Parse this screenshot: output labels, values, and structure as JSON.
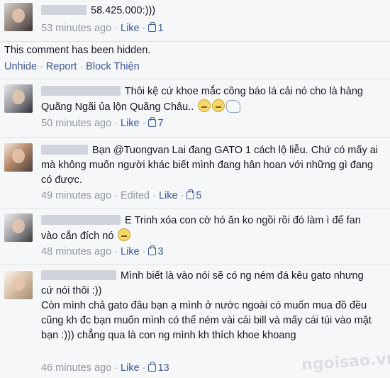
{
  "comments": [
    {
      "text": "58.425.000:)))",
      "time": "53 minutes ago",
      "edited": "",
      "like_label": "Like",
      "like_count": "1"
    },
    {
      "text": "Thôi kệ cứ khoe mắc công báo lá cải nó cho là hàng Quãng Ngãi ủa lộn Quãng Châu..",
      "time": "50 minutes ago",
      "edited": "",
      "like_label": "Like",
      "like_count": "7",
      "emoticons": [
        "unamused-face",
        "unamused-face",
        "claw-emoticon"
      ]
    },
    {
      "text": "Bạn @Tuongvan Lai đang GATO 1 cách lộ liễu. Chứ có mấy ai mà không muốn người khác biết mình đang hân hoan với những gì đang có được.",
      "time": "49 minutes ago",
      "edited": "Edited",
      "like_label": "Like",
      "like_count": "5"
    },
    {
      "text": "E Trinh xóa con cờ hó ăn ko ngồi rồi đó làm ì để fan vào cắn đích nó",
      "time": "48 minutes ago",
      "edited": "",
      "like_label": "Like",
      "like_count": "3",
      "emoticons": [
        "unamused-face"
      ]
    },
    {
      "text_line1": "Mình biết là vào nói sẽ có ng ném đá kêu gato nhưng cứ nói thôi :))",
      "text_line2": "Còn mình chả gato đâu bạn ạ mình ở nước ngoài có muốn mua đồ đều cũng kh đc bạn muốn mình có thể ném vài cái bill và mấy cái túi vào mặt bạn :))) chẳng qua là con ng mình kh thích khoe khoang",
      "time": "46 minutes ago",
      "edited": "",
      "like_label": "Like",
      "like_count": "13"
    }
  ],
  "hidden": {
    "message": "This comment has been hidden.",
    "unhide": "Unhide",
    "report": "Report",
    "block": "Block Thiện"
  },
  "separator": "·",
  "watermark": "ngoisao.vn",
  "colors": {
    "link": "#3b5998",
    "meta": "#9197a3",
    "background": "#f6f7f9"
  }
}
